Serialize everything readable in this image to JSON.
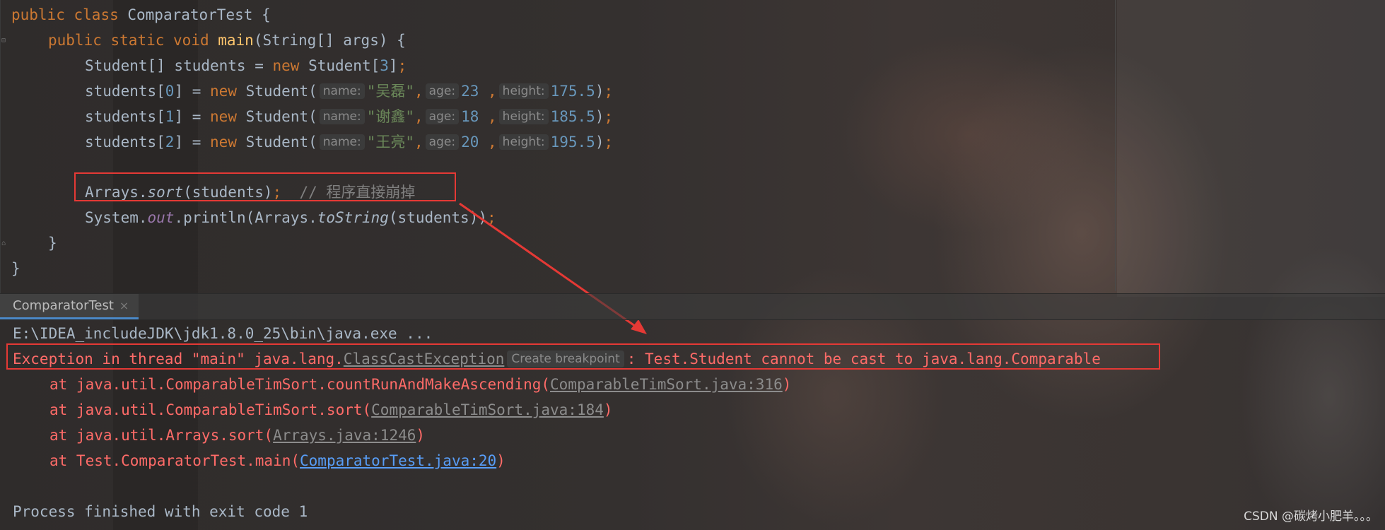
{
  "editor": {
    "lines": [
      {
        "tokens": [
          [
            "kw",
            "public "
          ],
          [
            "kw",
            "class "
          ],
          [
            "p",
            "ComparatorTest {"
          ]
        ]
      },
      {
        "tokens": [
          [
            "kw",
            "public "
          ],
          [
            "kw",
            "static "
          ],
          [
            "kw",
            "void "
          ],
          [
            "fn",
            "main"
          ],
          [
            "p",
            "(String[] args) {"
          ]
        ]
      },
      {
        "tokens": [
          [
            "p",
            "Student[] students = "
          ],
          [
            "kw",
            "new "
          ],
          [
            "p",
            "Student["
          ],
          [
            "num",
            "3"
          ],
          [
            "p",
            "]"
          ],
          [
            "kw",
            ";"
          ]
        ]
      },
      {
        "tokens": [
          [
            "p",
            "students["
          ],
          [
            "num",
            "0"
          ],
          [
            "p",
            "] = "
          ],
          [
            "kw",
            "new "
          ],
          [
            "p",
            "Student("
          ],
          [
            "hint",
            "name:"
          ],
          [
            "str",
            "\"吴磊\""
          ],
          [
            "kw",
            ","
          ],
          [
            "hint",
            "age:"
          ],
          [
            "num",
            "23"
          ],
          [
            "kw",
            " ,"
          ],
          [
            "hint",
            "height:"
          ],
          [
            "num",
            "175.5"
          ],
          [
            "p",
            ")"
          ],
          [
            "kw",
            ";"
          ]
        ]
      },
      {
        "tokens": [
          [
            "p",
            "students["
          ],
          [
            "num",
            "1"
          ],
          [
            "p",
            "] = "
          ],
          [
            "kw",
            "new "
          ],
          [
            "p",
            "Student("
          ],
          [
            "hint",
            "name:"
          ],
          [
            "str",
            "\"谢鑫\""
          ],
          [
            "kw",
            ","
          ],
          [
            "hint",
            "age:"
          ],
          [
            "num",
            "18"
          ],
          [
            "kw",
            " ,"
          ],
          [
            "hint",
            "height:"
          ],
          [
            "num",
            "185.5"
          ],
          [
            "p",
            ")"
          ],
          [
            "kw",
            ";"
          ]
        ]
      },
      {
        "tokens": [
          [
            "p",
            "students["
          ],
          [
            "num",
            "2"
          ],
          [
            "p",
            "] = "
          ],
          [
            "kw",
            "new "
          ],
          [
            "p",
            "Student("
          ],
          [
            "hint",
            "name:"
          ],
          [
            "str",
            "\"王亮\""
          ],
          [
            "kw",
            ","
          ],
          [
            "hint",
            "age:"
          ],
          [
            "num",
            "20"
          ],
          [
            "kw",
            " ,"
          ],
          [
            "hint",
            "height:"
          ],
          [
            "num",
            "195.5"
          ],
          [
            "p",
            ")"
          ],
          [
            "kw",
            ";"
          ]
        ]
      },
      {
        "tokens": []
      },
      {
        "tokens": [
          [
            "p",
            "Arrays."
          ],
          [
            "it",
            "sort"
          ],
          [
            "p",
            "(students)"
          ],
          [
            "kw",
            ";"
          ],
          [
            "cm",
            "  // 程序直接崩掉"
          ]
        ]
      },
      {
        "tokens": [
          [
            "p",
            "System."
          ],
          [
            "sf",
            "out"
          ],
          [
            "p",
            ".println(Arrays."
          ],
          [
            "it",
            "toString"
          ],
          [
            "p",
            "(students))"
          ],
          [
            "kw",
            ";"
          ]
        ]
      },
      {
        "tokens": [
          [
            "p",
            "}"
          ]
        ]
      },
      {
        "tokens": [
          [
            "p",
            "}"
          ]
        ]
      }
    ]
  },
  "run_tab": {
    "label": "ComparatorTest",
    "close": "×"
  },
  "console": {
    "command": "E:\\IDEA_includeJDK\\jdk1.8.0_25\\bin\\java.exe ...",
    "exception_prefix": "Exception in thread \"main\" java.lang.",
    "exception_class": "ClassCastException",
    "create_breakpoint": "Create breakpoint",
    "exception_message": ": Test.Student cannot be cast to java.lang.Comparable",
    "stack": [
      {
        "prefix": "at java.util.ComparableTimSort.countRunAndMakeAscending(",
        "link": "ComparableTimSort.java:316",
        "suffix": ")",
        "link_style": "gray"
      },
      {
        "prefix": "at java.util.ComparableTimSort.sort(",
        "link": "ComparableTimSort.java:184",
        "suffix": ")",
        "link_style": "gray"
      },
      {
        "prefix": "at java.util.Arrays.sort(",
        "link": "Arrays.java:1246",
        "suffix": ")",
        "link_style": "gray"
      },
      {
        "prefix": "at Test.ComparatorTest.main(",
        "link": "ComparatorTest.java:20",
        "suffix": ")",
        "link_style": "blue"
      }
    ],
    "exit": "Process finished with exit code 1"
  },
  "watermark": "CSDN @碳烤小肥羊。。。",
  "colors": {
    "annotation_red": "#e53935",
    "keyword": "#cc7832",
    "number": "#6897bb",
    "string": "#6a8759",
    "error": "#ff6b68",
    "link": "#589df6"
  }
}
